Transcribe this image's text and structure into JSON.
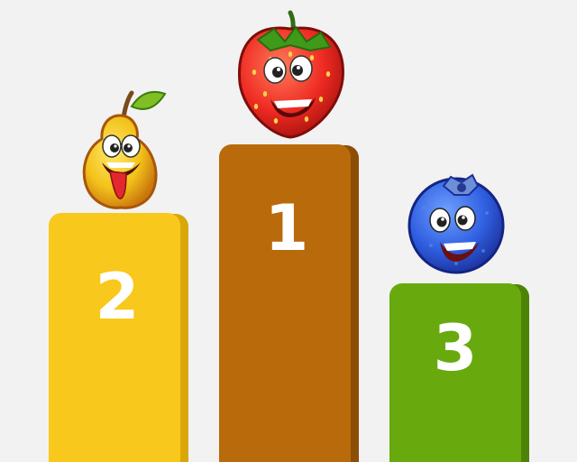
{
  "colors": {
    "background": "#f2f2f2",
    "podium_second": "#f8c81c",
    "podium_second_side": "#d9a70a",
    "podium_first": "#b96a0a",
    "podium_first_side": "#8c4e06",
    "podium_third": "#68aa0e",
    "podium_third_side": "#4d8407"
  },
  "podiums": [
    {
      "rank": "2",
      "character": "pear",
      "color": "#f8c81c"
    },
    {
      "rank": "1",
      "character": "strawberry",
      "color": "#b96a0a"
    },
    {
      "rank": "3",
      "character": "blueberry",
      "color": "#68aa0e"
    }
  ]
}
